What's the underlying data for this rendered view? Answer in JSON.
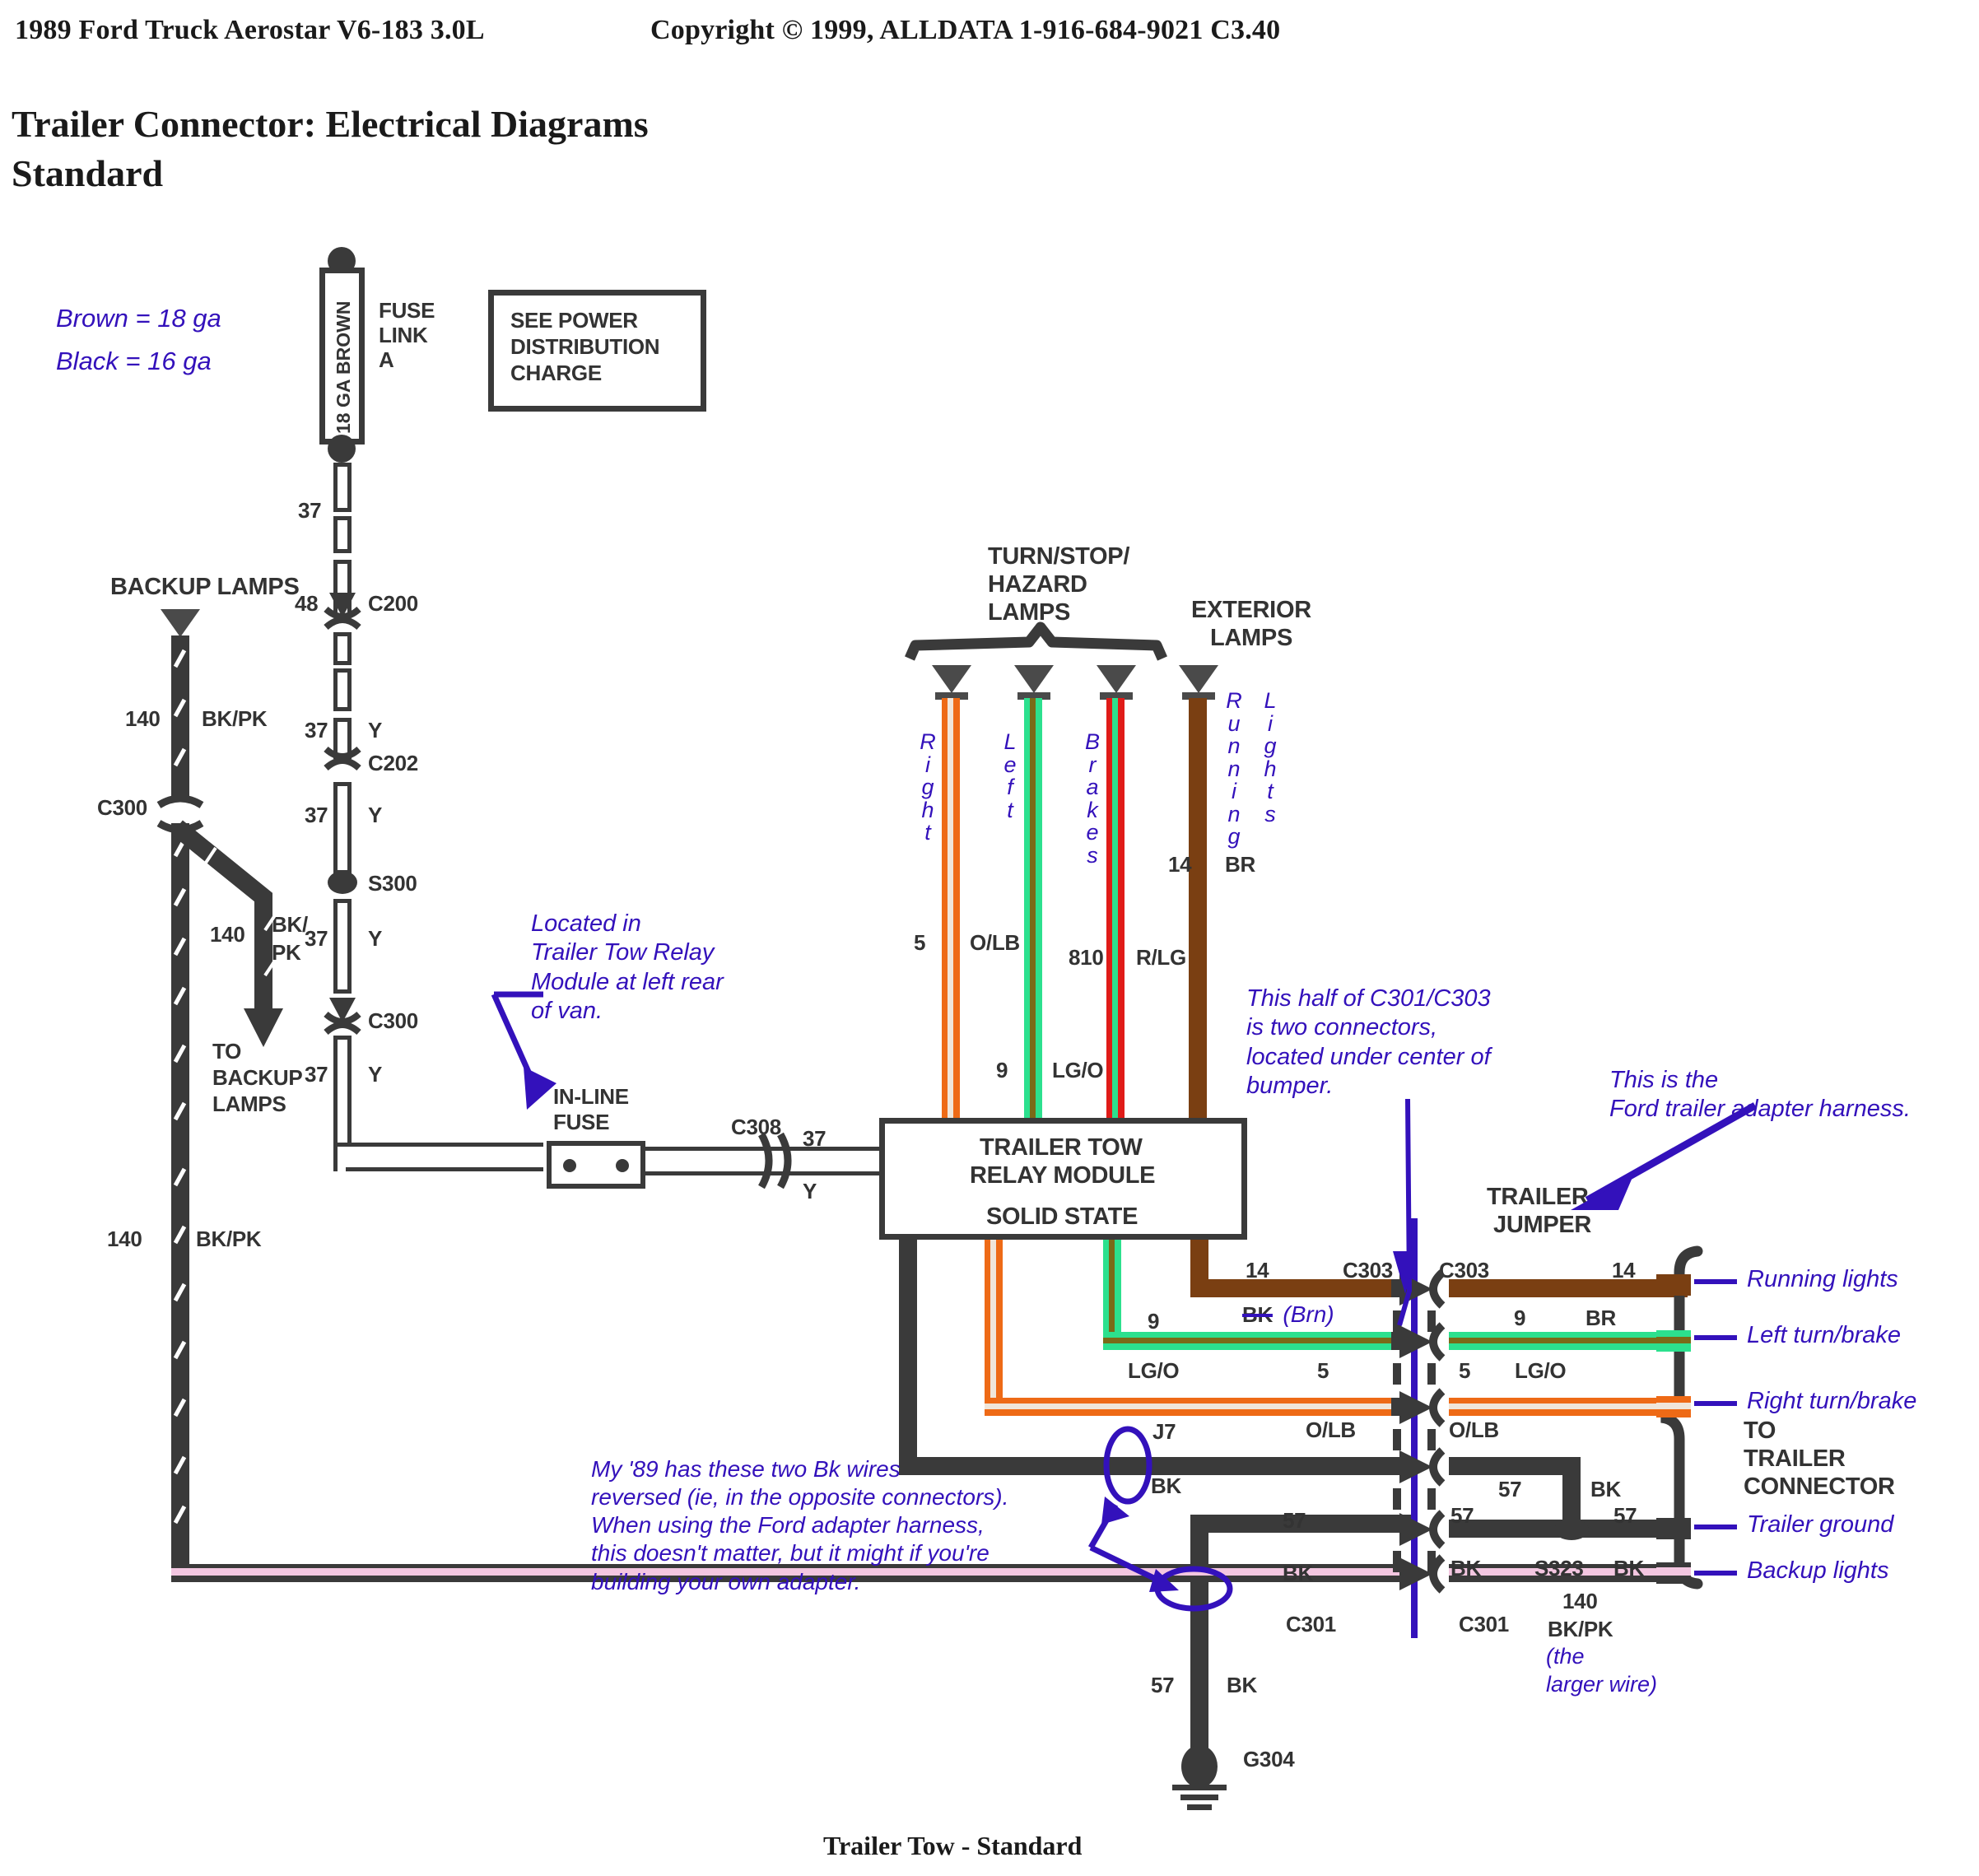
{
  "header": {
    "vehicle": "1989 Ford Truck Aerostar V6-183 3.0L",
    "copyright": "Copyright © 1999, ALLDATA  1-916-684-9021  C3.40",
    "title_line1": "Trailer Connector: Electrical Diagrams",
    "title_line2": "Standard"
  },
  "footer": {
    "caption": "Trailer Tow - Standard"
  },
  "legend_gauge": {
    "line1": "Brown = 18 ga",
    "line2": "Black = 16 ga"
  },
  "fuse_link": {
    "wire_label": "18 GA BROWN",
    "name_line1": "FUSE",
    "name_line2": "LINK",
    "name_line3": "A"
  },
  "power_box": {
    "line1": "SEE POWER",
    "line2": "DISTRIBUTION",
    "line3": "CHARGE"
  },
  "backup": {
    "title": "BACKUP LAMPS",
    "c300": "C300",
    "num_top": "140",
    "color_top": "BK/PK",
    "num_branch": "140",
    "color_branch_l1": "BK/",
    "color_branch_l2": "PK",
    "to_line1": "TO",
    "to_line2": "BACKUP",
    "to_line3": "LAMPS",
    "num_bottom": "140",
    "color_bottom": "BK/PK"
  },
  "feed_chain": [
    {
      "num": "37",
      "color": "",
      "connector": ""
    },
    {
      "num": "48",
      "color": "",
      "connector": "C200"
    },
    {
      "num": "37",
      "color": "Y",
      "connector": "C202"
    },
    {
      "num": "37",
      "color": "Y",
      "connector": "S300"
    },
    {
      "num": "37",
      "color": "Y",
      "connector": "C300"
    },
    {
      "num": "37",
      "color": "Y",
      "connector": ""
    }
  ],
  "inline_fuse": {
    "label_line1": "IN-LINE",
    "label_line2": "FUSE",
    "note": "Located in\nTrailer Tow Relay\nModule at left rear\nof van.",
    "out_connector": "C308",
    "out_num": "37",
    "out_color": "Y"
  },
  "lamps": {
    "turn_title_l1": "TURN/STOP/",
    "turn_title_l2": "HAZARD",
    "turn_title_l3": "LAMPS",
    "ext_title_l1": "EXTERIOR",
    "ext_title_l2": "LAMPS",
    "wires": [
      {
        "vname": "Right",
        "num": "5",
        "color": "O/LB",
        "swatch": "#ee6a16"
      },
      {
        "vname": "Left",
        "num": "9",
        "color": "LG/O",
        "swatch": "#2ce08e"
      },
      {
        "vname": "Brakes",
        "num": "810",
        "color": "R/LG",
        "swatch": "#e01b18"
      },
      {
        "vname": "Running Lights",
        "num": "14",
        "color": "BR",
        "swatch": "#7a3f12"
      }
    ]
  },
  "relay_module": {
    "line1": "TRAILER TOW",
    "line2": "RELAY MODULE",
    "line3": "SOLID STATE"
  },
  "notes": {
    "c301_c303": "This half of C301/C303\nis two connectors,\nlocated under center of\nbumper.",
    "adapter": "This is the\nFord trailer adapter harness.",
    "bk_reversed": "My '89 has these two Bk wires\nreversed (ie, in the opposite connectors).\nWhen using the Ford adapter harness,\nthis doesn't matter, but it might if you're\nbuilding your own adapter.",
    "bk_struck": "BK",
    "bk_struck_repl": "(Brn)",
    "larger_wire_l1": "(the",
    "larger_wire_l2": "larger wire)"
  },
  "trailer_jumper": {
    "title_l1": "TRAILER",
    "title_l2": "JUMPER"
  },
  "connector_rows_left": [
    {
      "num": "14",
      "color": "",
      "connector": "C303"
    },
    {
      "num": "9",
      "color": "",
      "connector": ""
    },
    {
      "num": "5",
      "color": "LG/O",
      "connector": ""
    },
    {
      "num": "",
      "color": "O/LB",
      "connector": ""
    },
    {
      "num": "",
      "color": "BK",
      "connector": "J7"
    },
    {
      "num": "57",
      "color": "BK",
      "connector": "C301"
    }
  ],
  "connector_rows_right": [
    {
      "num": "14",
      "color": "BR",
      "connector": "C303"
    },
    {
      "num": "9",
      "color": "",
      "connector": ""
    },
    {
      "num": "5",
      "color": "LG/O",
      "connector": ""
    },
    {
      "num": "",
      "color": "O/LB",
      "connector": ""
    },
    {
      "num": "57",
      "color": "BK",
      "connector": ""
    },
    {
      "num": "57",
      "color": "BK",
      "connector": "C301"
    }
  ],
  "splices": {
    "s323": "S323",
    "s300": "S300",
    "g304": "G304"
  },
  "ground_branch": {
    "num": "57",
    "color": "BK"
  },
  "right_legend": [
    {
      "label": "Running lights",
      "swatch": "#7a3f12"
    },
    {
      "label": "Left turn/brake",
      "swatch": "#2ce08e"
    },
    {
      "label": "Right turn/brake",
      "swatch": "#ee6a16"
    },
    {
      "label": "Trailer ground",
      "swatch": "#3a3a3a"
    },
    {
      "label": "Backup lights",
      "swatch": "#f3c6e0"
    }
  ],
  "to_trailer_connector": {
    "l1": "TO",
    "l2": "TRAILER",
    "l3": "CONNECTOR"
  },
  "trailer_end": {
    "num": "140",
    "color": "BK/PK"
  },
  "colors": {
    "wire_black": "#3a3a3a",
    "wire_brown": "#7a3f12",
    "wire_green": "#2ce08e",
    "wire_orange": "#ee6a16",
    "wire_red": "#e01b18",
    "wire_pink": "#f3c6e0",
    "annotation_blue": "#3311bb"
  }
}
